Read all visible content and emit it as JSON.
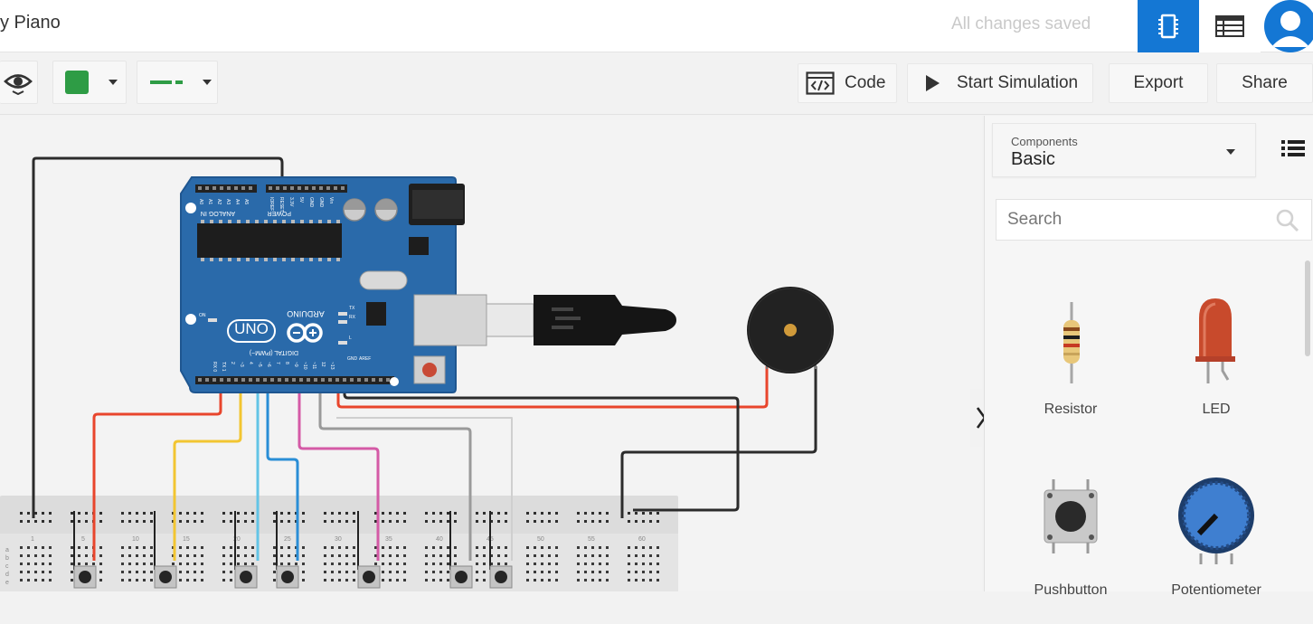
{
  "header": {
    "title": "y Piano",
    "save_status": "All changes saved",
    "circuit_view_icon": "component-chip-icon",
    "schematic_view_icon": "list-table-icon",
    "avatar_icon": "user-avatar-icon"
  },
  "toolbar": {
    "visibility_icon": "eye-icon",
    "fill_color": "#2e9c45",
    "wire_color": "#2e9c45",
    "code_label": "Code",
    "code_icon": "code-window-icon",
    "start_sim_label": "Start Simulation",
    "start_sim_icon": "play-icon",
    "export_label": "Export",
    "share_label": "Share"
  },
  "panel": {
    "components_label": "Components",
    "components_value": "Basic",
    "list_view_icon": "list-view-icon",
    "search_placeholder": "Search",
    "search_icon": "search-icon",
    "collapse_icon": "chevron-right-icon",
    "items": [
      {
        "label": "Resistor",
        "icon": "resistor-icon"
      },
      {
        "label": "LED",
        "icon": "led-icon"
      },
      {
        "label": "Pushbutton",
        "icon": "pushbutton-icon"
      },
      {
        "label": "Potentiometer",
        "icon": "potentiometer-icon"
      }
    ]
  },
  "canvas": {
    "board": {
      "brand": "ARDUINO",
      "model": "UNO",
      "header_power": "POWER",
      "header_analog": "ANALOG IN",
      "header_digital": "DIGITAL (PWM~)",
      "power_pins": [
        "IOREF",
        "RESET",
        "3.3V",
        "5V",
        "GND",
        "GND",
        "Vin"
      ],
      "analog_pins": [
        "A0",
        "A1",
        "A2",
        "A3",
        "A4",
        "A5"
      ],
      "digital_pins": [
        "~13",
        "12",
        "~11",
        "~10",
        "~9",
        "8",
        "7",
        "~6",
        "~5",
        "4",
        "~3",
        "2",
        "TX 1",
        "RX 0"
      ],
      "other_labels": [
        "AREF",
        "GND",
        "TX",
        "RX",
        "L",
        "ON"
      ]
    },
    "breadboard_columns": [
      "1",
      "5",
      "10",
      "15",
      "20",
      "25",
      "30",
      "35",
      "40",
      "45",
      "50",
      "55",
      "60"
    ],
    "breadboard_rows": [
      "a",
      "b",
      "c",
      "d",
      "e"
    ],
    "wire_colors": {
      "black": "#2b2b2b",
      "red": "#e8452c",
      "yellow": "#f2c531",
      "light_blue": "#63c4e6",
      "blue": "#2a8ed6",
      "pink": "#d45aa6",
      "gray": "#9a9a9a"
    }
  }
}
